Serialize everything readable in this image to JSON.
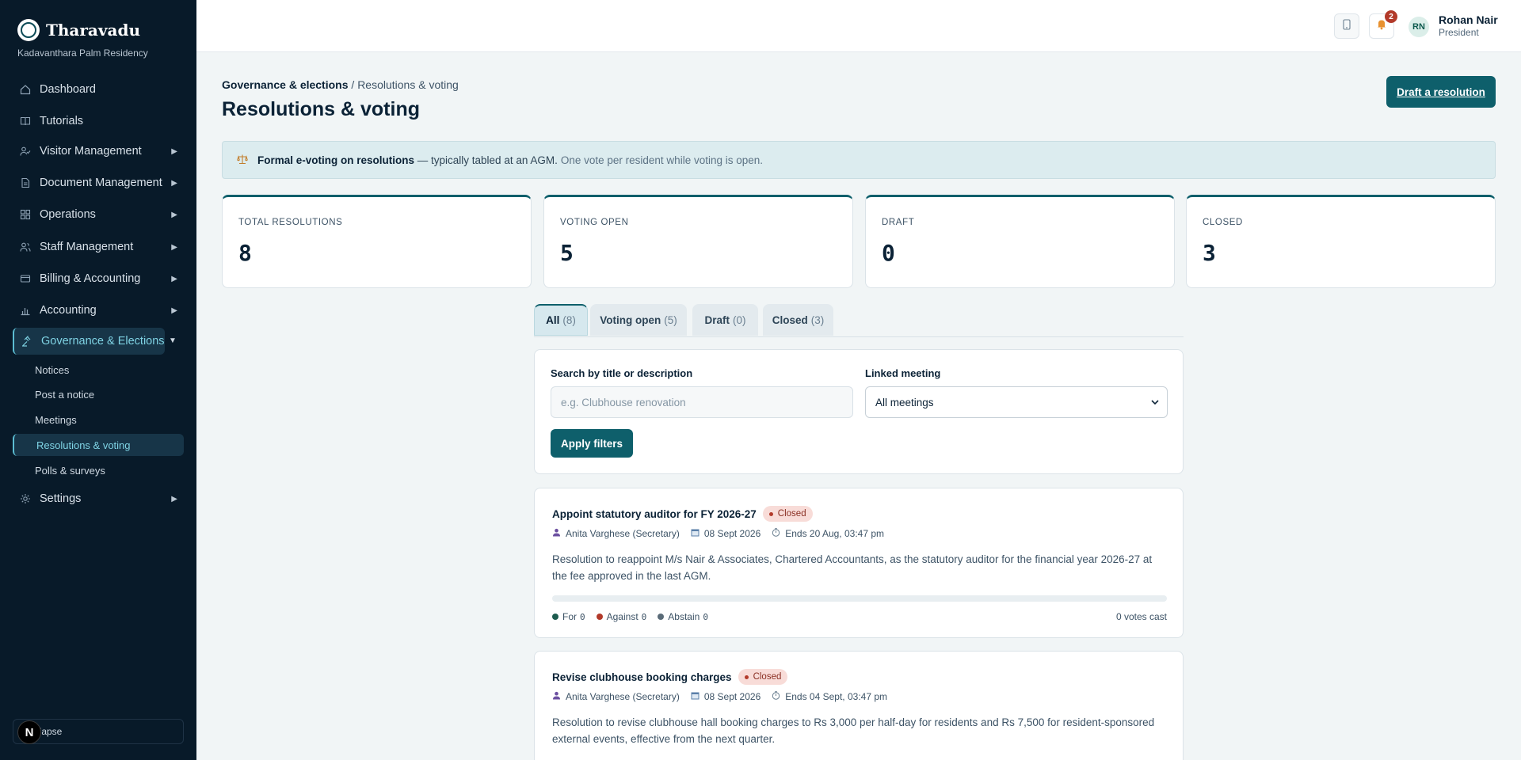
{
  "brand": {
    "name": "Tharavadu",
    "society": "Kadavanthara Palm Residency"
  },
  "sidebar": {
    "items": [
      {
        "label": "Dashboard",
        "icon": "home-icon"
      },
      {
        "label": "Tutorials",
        "icon": "book-icon"
      },
      {
        "label": "Visitor Management",
        "icon": "visitor-icon"
      },
      {
        "label": "Document Management",
        "icon": "document-icon"
      },
      {
        "label": "Operations",
        "icon": "grid-icon"
      },
      {
        "label": "Staff Management",
        "icon": "staff-icon"
      },
      {
        "label": "Billing & Accounting",
        "icon": "billing-icon"
      },
      {
        "label": "Accounting",
        "icon": "chart-icon"
      },
      {
        "label": "Governance & Elections",
        "icon": "gavel-icon"
      },
      {
        "label": "Settings",
        "icon": "gear-icon"
      }
    ],
    "sub_items": [
      {
        "label": "Notices"
      },
      {
        "label": "Post a notice"
      },
      {
        "label": "Meetings"
      },
      {
        "label": "Resolutions & voting"
      },
      {
        "label": "Polls & surveys"
      }
    ],
    "collapse_label": "ilapse",
    "next_badge": "N"
  },
  "topbar": {
    "notification_count": "2",
    "user_initials": "RN",
    "user_name": "Rohan Nair",
    "user_role": "President"
  },
  "page": {
    "breadcrumb_parent": "Governance & elections",
    "breadcrumb_sep": " / ",
    "breadcrumb_current": "Resolutions & voting",
    "title": "Resolutions & voting",
    "draft_button": "Draft a resolution"
  },
  "banner": {
    "bold": "Formal e-voting on resolutions",
    "text": " — typically tabled at an AGM.",
    "muted": "One vote per resident while voting is open."
  },
  "stats": [
    {
      "label": "TOTAL RESOLUTIONS",
      "value": "8"
    },
    {
      "label": "VOTING OPEN",
      "value": "5"
    },
    {
      "label": "DRAFT",
      "value": "0"
    },
    {
      "label": "CLOSED",
      "value": "3"
    }
  ],
  "tabs": [
    {
      "label": "All",
      "count": "(8)"
    },
    {
      "label": "Voting open",
      "count": "(5)"
    },
    {
      "label": "Draft",
      "count": "(0)"
    },
    {
      "label": "Closed",
      "count": "(3)"
    }
  ],
  "filters": {
    "search_label": "Search by title or description",
    "search_placeholder": "e.g. Clubhouse renovation",
    "meeting_label": "Linked meeting",
    "meeting_value": "All meetings",
    "apply_label": "Apply filters"
  },
  "resolutions": [
    {
      "title": "Appoint statutory auditor for FY 2026-27",
      "status": "Closed",
      "author": "Anita Varghese (Secretary)",
      "date": "08 Sept 2026",
      "ends": "Ends 20 Aug, 03:47 pm",
      "description": "Resolution to reappoint M/s Nair & Associates, Chartered Accountants, as the statutory auditor for the financial year 2026-27 at the fee approved in the last AGM.",
      "for_label": "For",
      "for_count": "0",
      "against_label": "Against",
      "against_count": "0",
      "abstain_label": "Abstain",
      "abstain_count": "0",
      "votes_cast": "0 votes cast"
    },
    {
      "title": "Revise clubhouse booking charges",
      "status": "Closed",
      "author": "Anita Varghese (Secretary)",
      "date": "08 Sept 2026",
      "ends": "Ends 04 Sept, 03:47 pm",
      "description": "Resolution to revise clubhouse hall booking charges to Rs 3,000 per half-day for residents and Rs 7,500 for resident-sponsored external events, effective from the next quarter."
    }
  ],
  "colors": {
    "sidebar_bg": "#081a29",
    "accent": "#0e5f6b",
    "closed_badge_bg": "#f8dcd8",
    "for_dot": "#1d5c4f",
    "against_dot": "#b23a2a",
    "abstain_dot": "#5a6b78"
  }
}
